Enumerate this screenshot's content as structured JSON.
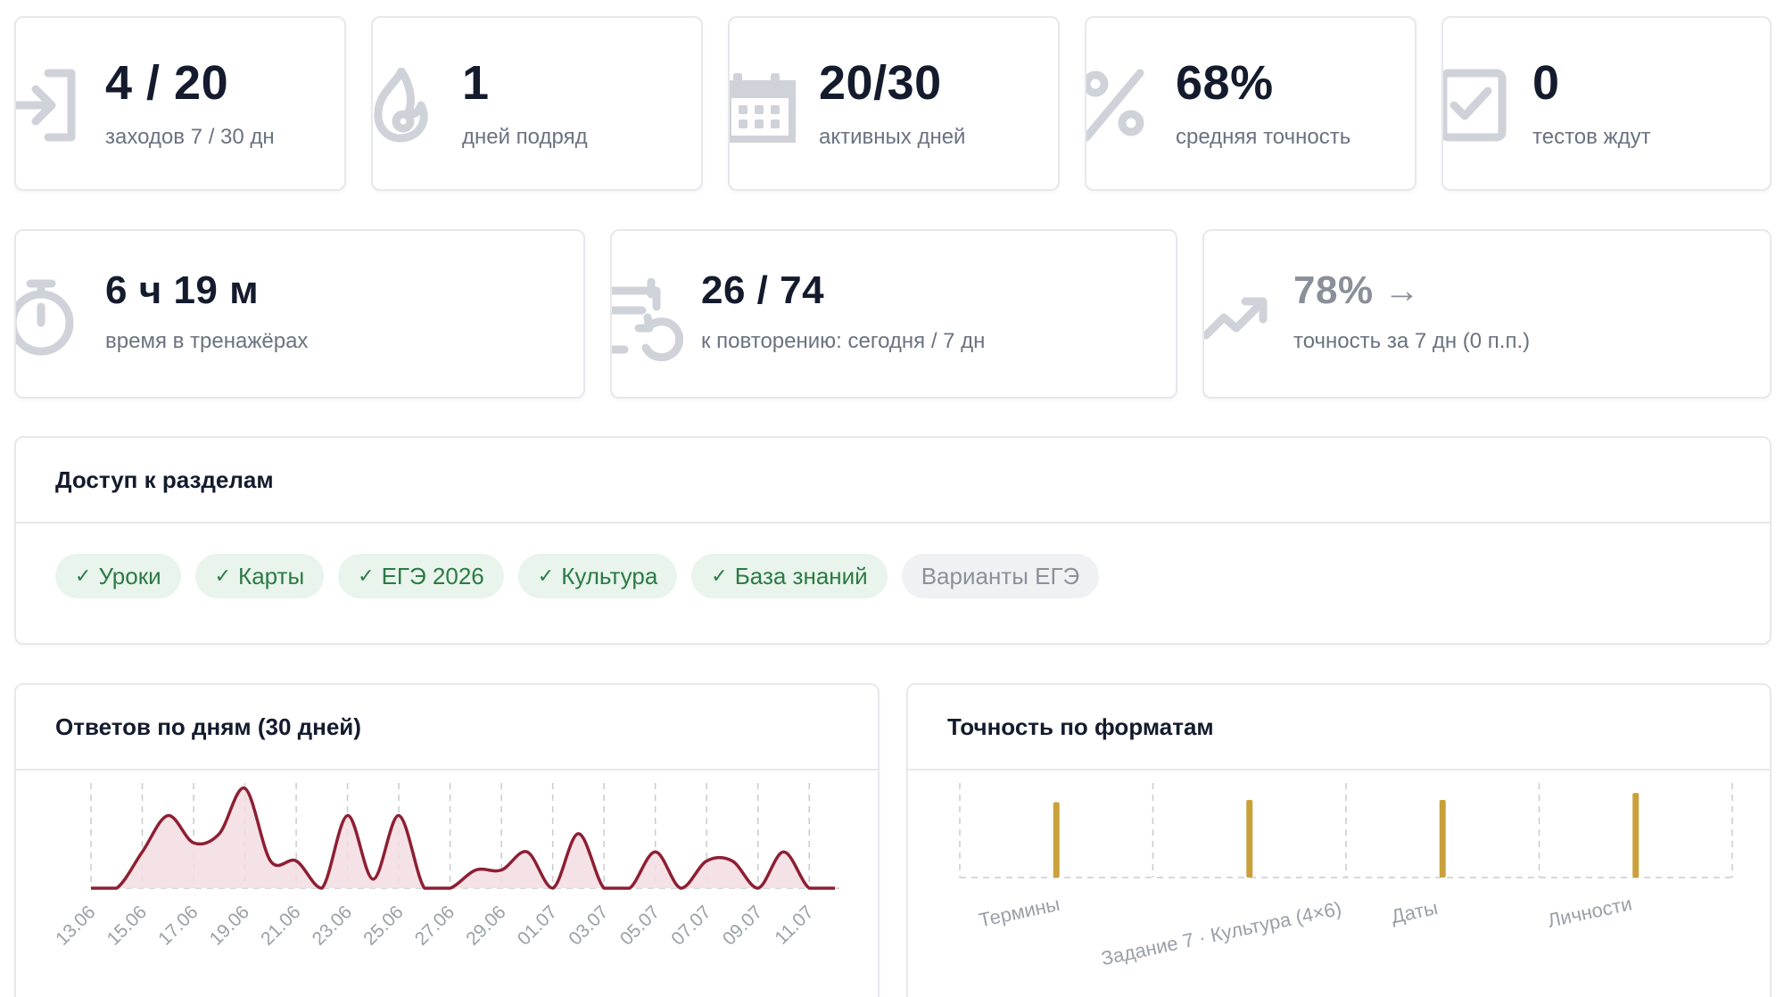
{
  "stats_row1": [
    {
      "icon": "login-icon",
      "value": "4 / 20",
      "label": "заходов 7 / 30 дн"
    },
    {
      "icon": "fire-icon",
      "value": "1",
      "label": "дней подряд"
    },
    {
      "icon": "calendar-icon",
      "value": "20/30",
      "label": "активных дней"
    },
    {
      "icon": "percent-icon",
      "value": "68%",
      "label": "средняя точность"
    },
    {
      "icon": "checklist-icon",
      "value": "0",
      "label": "тестов ждут"
    }
  ],
  "stats_row2": [
    {
      "icon": "stopwatch-icon",
      "value": "6 ч 19 м",
      "label": "время в тренажёрах"
    },
    {
      "icon": "calendar-repeat-icon",
      "value": "26 / 74",
      "label": "к повторению: сегодня / 7 дн"
    },
    {
      "icon": "trend-up-icon",
      "value": "78%",
      "arrow": "→",
      "label": "точность за 7 дн (0 п.п.)"
    }
  ],
  "access": {
    "title": "Доступ к разделам",
    "check_glyph": "✓",
    "chips": [
      {
        "label": "Уроки",
        "enabled": true
      },
      {
        "label": "Карты",
        "enabled": true
      },
      {
        "label": "ЕГЭ 2026",
        "enabled": true
      },
      {
        "label": "Культура",
        "enabled": true
      },
      {
        "label": "База знаний",
        "enabled": true
      },
      {
        "label": "Варианты ЕГЭ",
        "enabled": false
      }
    ]
  },
  "answers_panel": {
    "title": "Ответов по дням (30 дней)"
  },
  "accuracy_panel": {
    "title": "Точность по форматам"
  },
  "colors": {
    "line": "#8e1f33",
    "area": "#f3dde2",
    "bar": "#c9a03a",
    "grid": "#c8cbd0",
    "tick": "#9aa0a8"
  },
  "chart_data": [
    {
      "type": "area",
      "title": "Ответов по дням (30 дней)",
      "x": [
        "13.06",
        "14.06",
        "15.06",
        "16.06",
        "17.06",
        "18.06",
        "19.06",
        "20.06",
        "21.06",
        "22.06",
        "23.06",
        "24.06",
        "25.06",
        "26.06",
        "27.06",
        "28.06",
        "29.06",
        "30.06",
        "01.07",
        "02.07",
        "03.07",
        "04.07",
        "05.07",
        "06.07",
        "07.07",
        "08.07",
        "09.07",
        "10.07",
        "11.07",
        "12.07"
      ],
      "tick_labels": [
        "13.06",
        "15.06",
        "17.06",
        "19.06",
        "21.06",
        "23.06",
        "25.06",
        "27.06",
        "29.06",
        "01.07",
        "03.07",
        "05.07",
        "07.07",
        "09.07",
        "11.07"
      ],
      "values": [
        0,
        0,
        4,
        8,
        5,
        6,
        11,
        3,
        3,
        0,
        8,
        1,
        8,
        0,
        0,
        2,
        2,
        4,
        0,
        6,
        0,
        0,
        4,
        0,
        3,
        3,
        0,
        4,
        0,
        0
      ],
      "grid": true
    },
    {
      "type": "bar",
      "title": "Точность по форматам",
      "categories": [
        "Термины",
        "Задание 7 · Культура (4×6)",
        "Даты",
        "Личности"
      ],
      "values": [
        66,
        68,
        68,
        74
      ],
      "ylim": [
        0,
        100
      ],
      "grid": true
    }
  ]
}
